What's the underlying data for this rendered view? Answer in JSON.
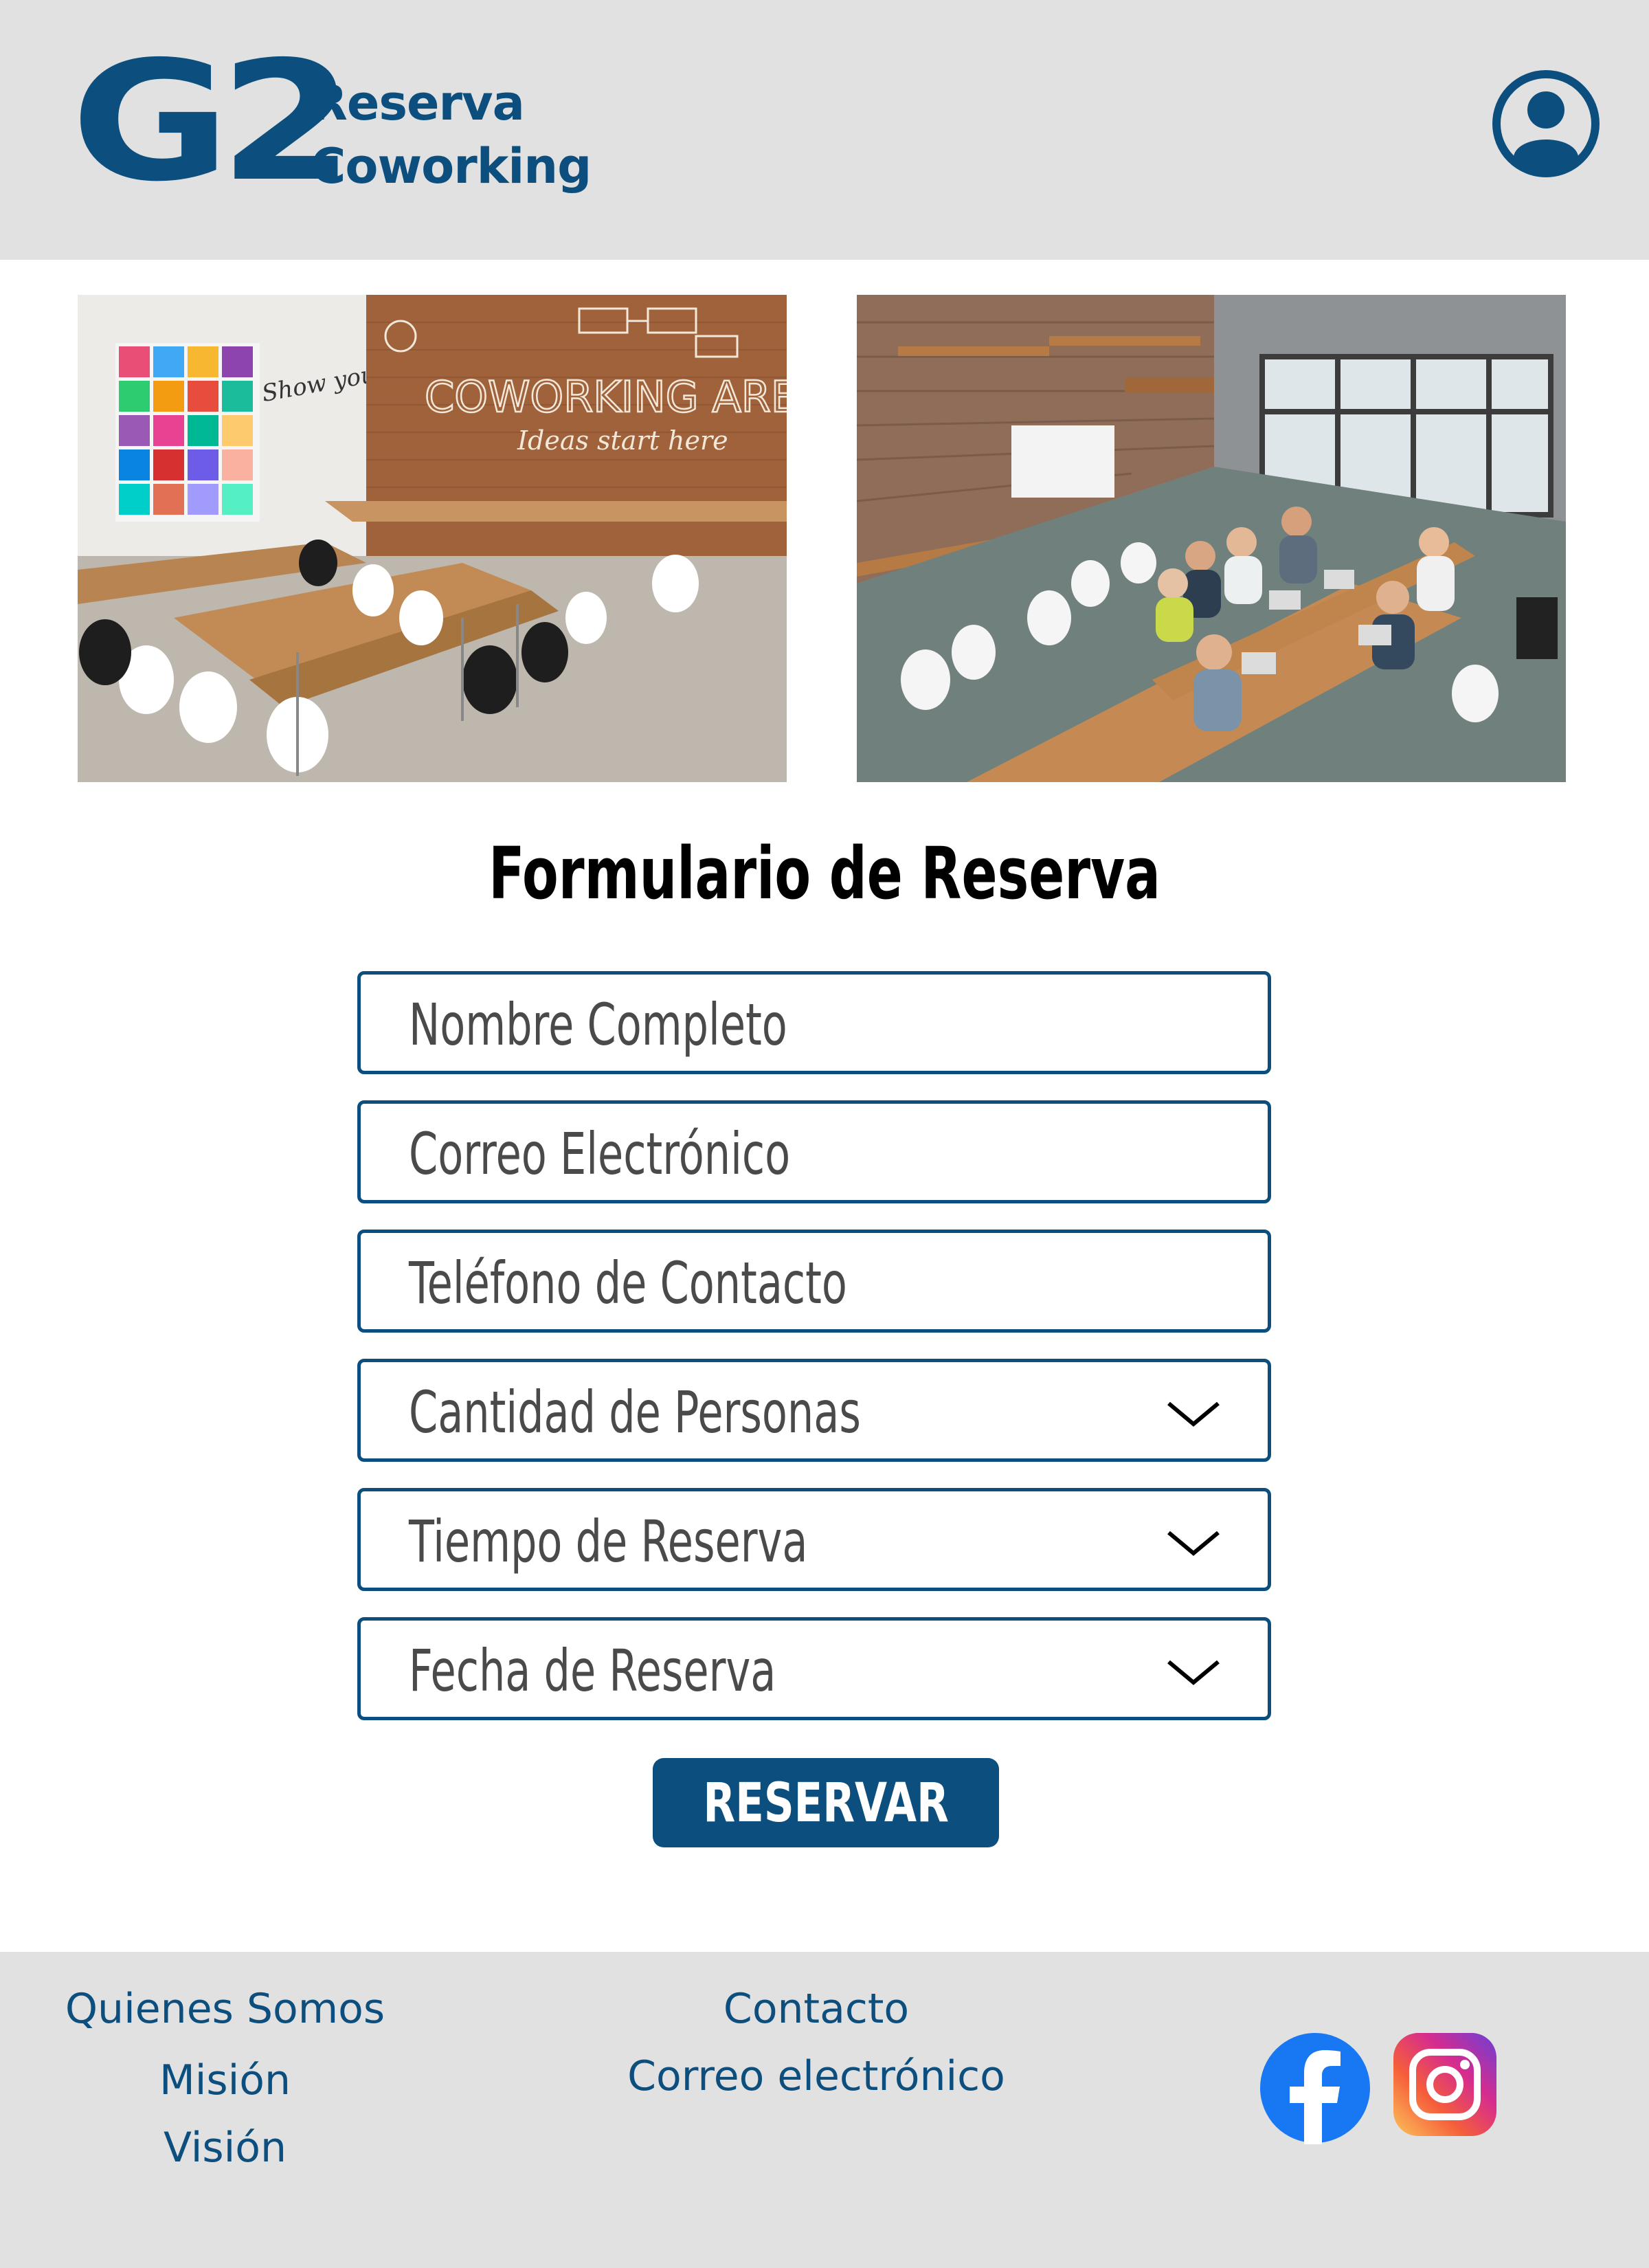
{
  "header": {
    "logo_mark": "G2",
    "logo_line1": "Reserva",
    "logo_line2": "Coworking",
    "avatar_icon": "user-circle-icon"
  },
  "photos": [
    {
      "caption_line1": "COWORKING AREA",
      "caption_line2": "Ideas start here",
      "side_text": "Show your work"
    },
    {}
  ],
  "form": {
    "title": "Formulario de Reserva",
    "fields": [
      {
        "placeholder": "Nombre Completo",
        "type": "text"
      },
      {
        "placeholder": "Correo Electrónico",
        "type": "text"
      },
      {
        "placeholder": "Teléfono de Contacto",
        "type": "text"
      },
      {
        "placeholder": "Cantidad de Personas",
        "type": "select",
        "icon": "chevron-down-icon"
      },
      {
        "placeholder": "Tiempo de Reserva",
        "type": "select",
        "icon": "chevron-down-icon"
      },
      {
        "placeholder": "Fecha de Reserva",
        "type": "select",
        "icon": "chevron-down-icon"
      }
    ],
    "submit_label": "RESERVAR"
  },
  "footer": {
    "col1": [
      "Quienes Somos",
      "Misión",
      "Visión"
    ],
    "col2": [
      "Contacto",
      "Correo electrónico"
    ],
    "social": [
      "facebook-icon",
      "instagram-icon"
    ]
  },
  "colors": {
    "brand": "#0c4f7f",
    "header_bg": "#e1e1e1",
    "footer_bg": "#e1e1e1"
  }
}
